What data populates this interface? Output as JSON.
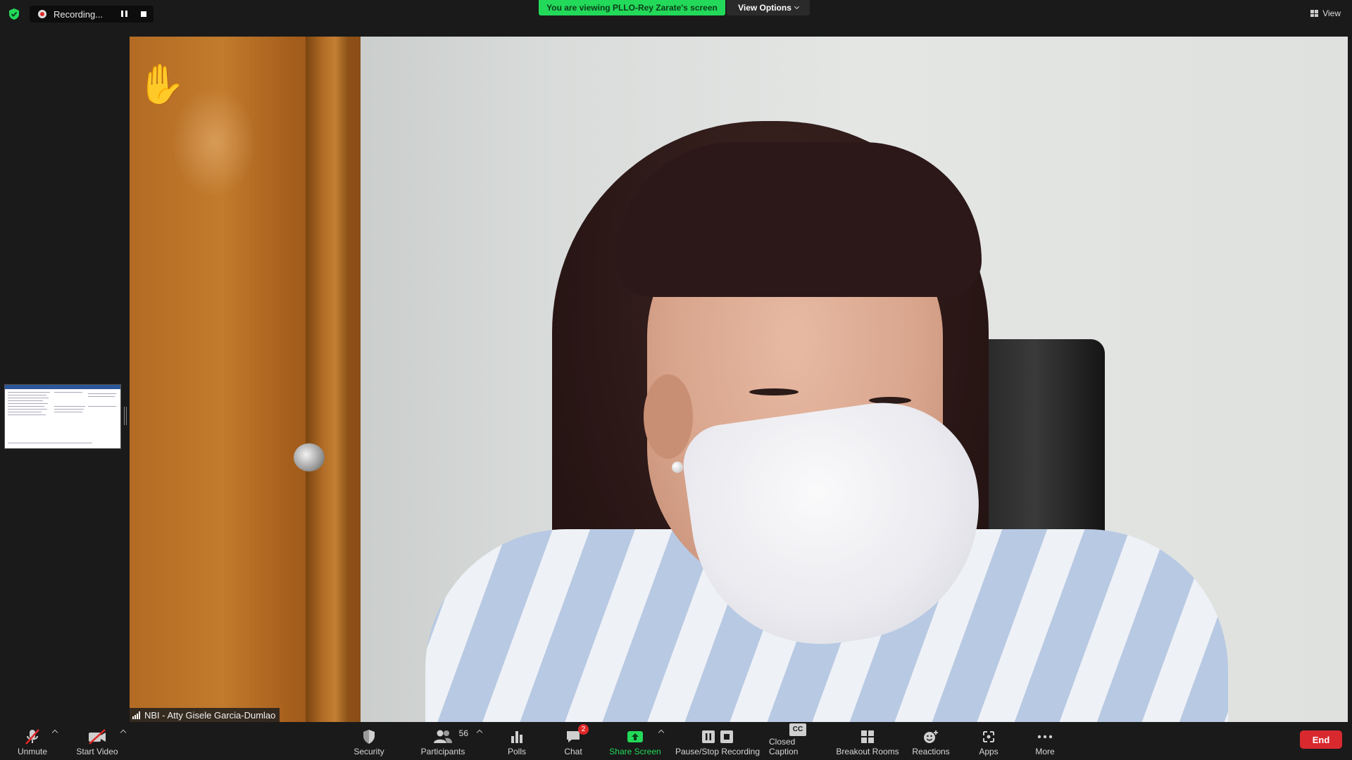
{
  "top": {
    "recording_label": "Recording...",
    "viewing_banner": "You are viewing PLLO-Rey Zarate's screen",
    "view_options_label": "View Options",
    "view_label": "View"
  },
  "video": {
    "participant_name": "NBI - Atty Gisele Garcia-Dumlao",
    "raised_hand": "✋"
  },
  "toolbar": {
    "unmute": "Unmute",
    "start_video": "Start Video",
    "security": "Security",
    "participants": "Participants",
    "participants_count": "56",
    "polls": "Polls",
    "chat": "Chat",
    "chat_badge": "2",
    "share_screen": "Share Screen",
    "pause_stop_recording": "Pause/Stop Recording",
    "closed_caption": "Closed Caption",
    "cc_glyph": "CC",
    "breakout_rooms": "Breakout Rooms",
    "reactions": "Reactions",
    "apps": "Apps",
    "more": "More",
    "end": "End"
  },
  "colors": {
    "share_green": "#23d959",
    "end_red": "#d8292f",
    "badge_red": "#e02828"
  }
}
